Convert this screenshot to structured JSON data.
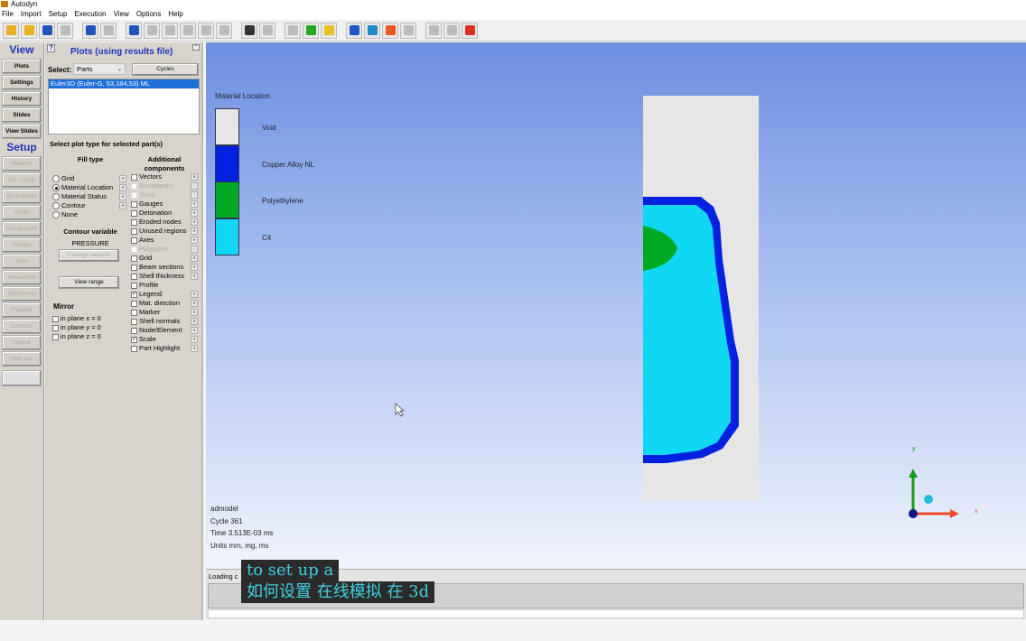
{
  "app": {
    "title": "Autodyn"
  },
  "menu": [
    "File",
    "Import",
    "Setup",
    "Execution",
    "View",
    "Options",
    "Help"
  ],
  "toolbar": [
    "load-icon",
    "save-icon",
    "save-as-icon",
    "print-icon",
    "sync-icon",
    "bulb-icon",
    "refresh-icon",
    "pan-icon",
    "zoom-icon",
    "axes-icon",
    "fit-icon",
    "zoom-box-icon",
    "eye-icon",
    "graph-icon",
    "gray-icon",
    "green-box-icon",
    "lightning-icon",
    "s-icon",
    "camera-icon",
    "record-icon",
    "text-icon",
    "clipboard-icon",
    "blank-icon",
    "stop-icon"
  ],
  "nav": {
    "view_header": "View",
    "view_items": [
      "Plots",
      "Settings",
      "History",
      "Slides",
      "View Slides"
    ],
    "setup_header": "Setup",
    "setup_items": [
      "Material",
      "Init. Cond.",
      "Boundaries",
      "Parts",
      "Component",
      "Groups",
      "Joins",
      "Interaction",
      "Detonation",
      "Parallel",
      "Controls",
      "Output",
      "User var."
    ]
  },
  "panel": {
    "help": "?",
    "title": "Plots (using results file)",
    "select_label": "Select:",
    "select_value": "Parts",
    "cycles_button": "Cycles",
    "list_items": [
      "Euler3D (Euler-G, 53,184,53) ML"
    ],
    "plot_type_heading": "Select plot type for selected part(s)",
    "fill_type_heading": "Fill type",
    "fill_types": [
      {
        "label": "Grid",
        "selected": false
      },
      {
        "label": "Material Location",
        "selected": true
      },
      {
        "label": "Material Status",
        "selected": false
      },
      {
        "label": "Contour",
        "selected": false
      },
      {
        "label": "None",
        "selected": false
      }
    ],
    "contour_heading": "Contour variable",
    "contour_value": "PRESSURE",
    "change_variable": "Change variable",
    "view_range": "View range",
    "mirror_heading": "Mirror",
    "mirror": [
      "in plane x = 0",
      "in plane y = 0",
      "in plane z = 0"
    ],
    "additional_heading": "Additional components",
    "components": [
      {
        "label": "Vectors",
        "checked": false,
        "enabled": true
      },
      {
        "label": "Boundaries",
        "checked": false,
        "enabled": false
      },
      {
        "label": "Joins",
        "checked": false,
        "enabled": false
      },
      {
        "label": "Gauges",
        "checked": false,
        "enabled": true
      },
      {
        "label": "Detonation",
        "checked": false,
        "enabled": true
      },
      {
        "label": "Eroded nodes",
        "checked": false,
        "enabled": true
      },
      {
        "label": "Unused regions",
        "checked": false,
        "enabled": true
      },
      {
        "label": "Axes",
        "checked": false,
        "enabled": true
      },
      {
        "label": "Polygons",
        "checked": false,
        "enabled": false
      },
      {
        "label": "Grid",
        "checked": false,
        "enabled": true
      },
      {
        "label": "Beam sections",
        "checked": false,
        "enabled": true
      },
      {
        "label": "Shell thickness",
        "checked": false,
        "enabled": true
      },
      {
        "label": "Profile",
        "checked": false,
        "enabled": true
      },
      {
        "label": "Legend",
        "checked": true,
        "enabled": true
      },
      {
        "label": "Mat. direction",
        "checked": false,
        "enabled": true
      },
      {
        "label": "Marker",
        "checked": false,
        "enabled": true
      },
      {
        "label": "Shell normals",
        "checked": false,
        "enabled": true
      },
      {
        "label": "Node/Element",
        "checked": false,
        "enabled": true
      },
      {
        "label": "Scale",
        "checked": true,
        "enabled": true
      },
      {
        "label": "Part Highlight",
        "checked": false,
        "enabled": true
      }
    ]
  },
  "legend": {
    "title": "Material Location",
    "items": [
      {
        "label": "Void",
        "color": "#e6e6e6"
      },
      {
        "label": "Copper Alloy NL",
        "color": "#0022e0"
      },
      {
        "label": "Polyethylene",
        "color": "#00aa22"
      },
      {
        "label": "C4",
        "color": "#10d8f4"
      }
    ]
  },
  "info": {
    "model": "admodel",
    "cycle": "Cycle 361",
    "time": "Time 3.513E-03 ms",
    "units": "Units mm, mg, ms"
  },
  "triad": {
    "y": "y",
    "x": "x"
  },
  "status": {
    "text": "Loading c"
  },
  "caption": {
    "line1": "to set up a",
    "line2": "如何设置 在线模拟 在 3d"
  }
}
